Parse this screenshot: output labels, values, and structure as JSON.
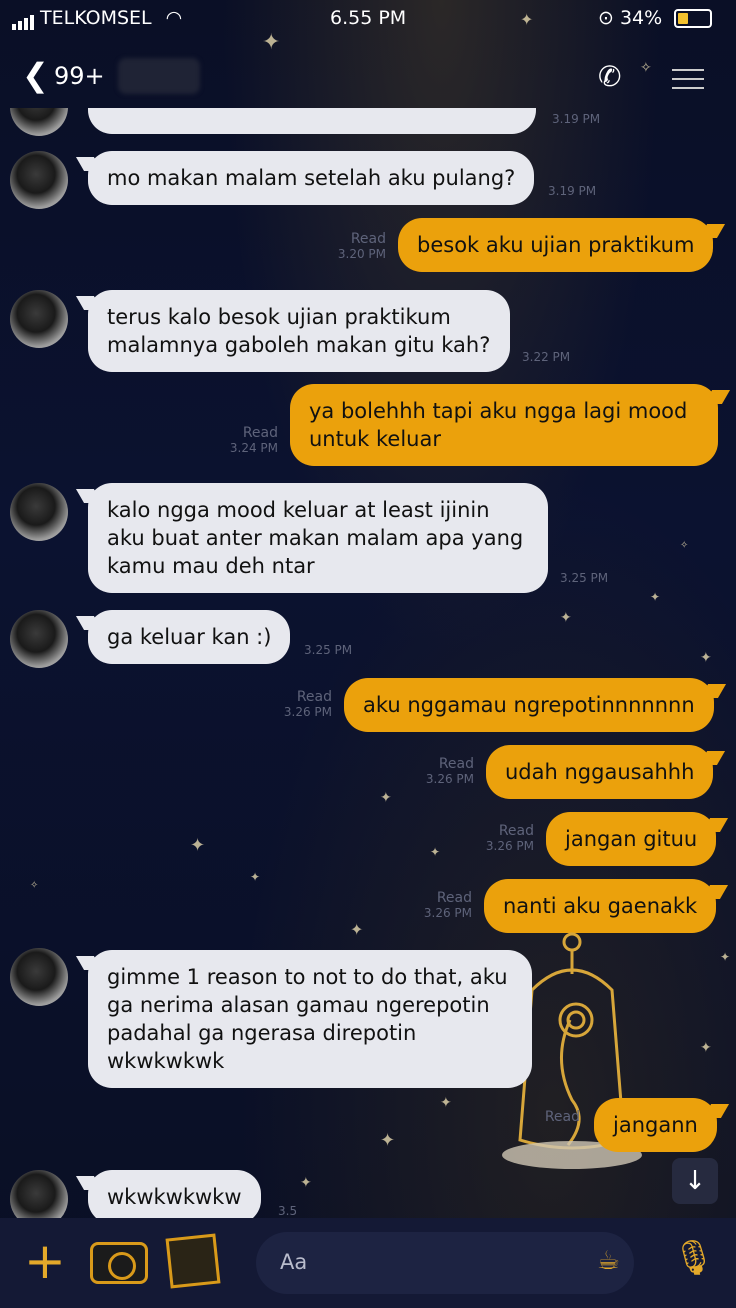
{
  "status_bar": {
    "carrier": "TELKOMSEL",
    "time": "6.55 PM",
    "battery": "34%"
  },
  "header": {
    "back_icon": "chevron-left-icon",
    "unread_count": "99+",
    "call_icon": "phone-icon",
    "menu_icon": "menu-icon"
  },
  "messages": [
    {
      "side": "in",
      "text": "",
      "time": "3.19 PM",
      "read": ""
    },
    {
      "side": "in",
      "text": "mo makan malam setelah aku pulang?",
      "time": "3.19 PM",
      "read": ""
    },
    {
      "side": "out",
      "text": "besok aku ujian praktikum",
      "time": "3.20 PM",
      "read": "Read"
    },
    {
      "side": "in",
      "text": "terus kalo besok ujian praktikum malamnya gaboleh makan gitu kah?",
      "time": "3.22 PM",
      "read": ""
    },
    {
      "side": "out",
      "text": "ya bolehhh tapi aku ngga lagi mood untuk keluar",
      "time": "3.24 PM",
      "read": "Read"
    },
    {
      "side": "in",
      "text": "kalo ngga mood keluar at least ijinin aku buat anter makan malam apa yang kamu mau deh ntar",
      "time": "3.25 PM",
      "read": ""
    },
    {
      "side": "in",
      "text": "ga keluar kan :)",
      "time": "3.25 PM",
      "read": ""
    },
    {
      "side": "out",
      "text": "aku nggamau ngrepotinnnnnnn",
      "time": "3.26 PM",
      "read": "Read"
    },
    {
      "side": "out",
      "text": "udah nggausahhh",
      "time": "3.26 PM",
      "read": "Read"
    },
    {
      "side": "out",
      "text": "jangan gituu",
      "time": "3.26 PM",
      "read": "Read"
    },
    {
      "side": "out",
      "text": "nanti aku gaenakk",
      "time": "3.26 PM",
      "read": "Read"
    },
    {
      "side": "in",
      "text": "gimme 1 reason to not to do that, aku ga nerima alasan gamau ngerepotin padahal ga ngerasa direpotin wkwkwkwk",
      "time": "",
      "read": ""
    },
    {
      "side": "out",
      "text": "jangann",
      "time": "",
      "read": "Read"
    },
    {
      "side": "in",
      "text": "wkwkwkwkw",
      "time": "3.5",
      "read": ""
    }
  ],
  "input": {
    "placeholder": "Aa",
    "plus_icon": "plus-icon",
    "camera_icon": "camera-icon",
    "gallery_icon": "gallery-icon",
    "sticker_icon": "teapot-sticker-icon",
    "mic_icon": "microphone-icon"
  },
  "colors": {
    "incoming_bubble": "#e7e8ee",
    "outgoing_bubble": "#eba10c",
    "background": "#0b1230",
    "accent": "#e4a92a"
  }
}
